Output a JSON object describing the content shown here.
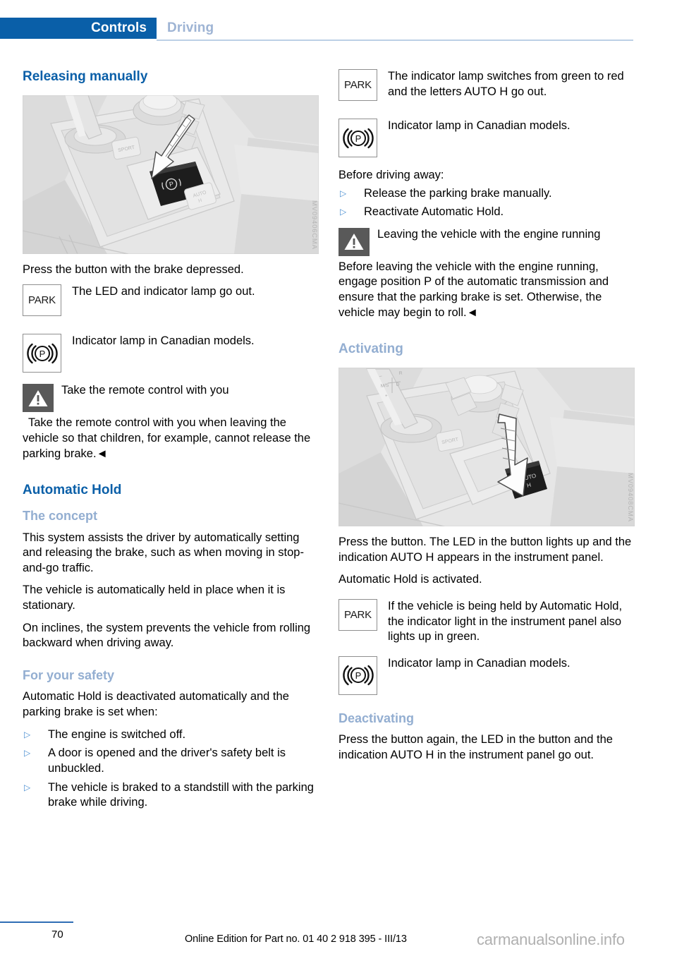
{
  "header": {
    "tab_label": "Controls",
    "section_label": "Driving"
  },
  "left_column": {
    "title": "Releasing manually",
    "figure": {
      "caption_wm": "MV09406CMA",
      "alt": "Center console with arrow pointing at parking brake button"
    },
    "intro": "Press the button with the brake depressed.",
    "icon_items": [
      {
        "icon": "park-indicator-icon",
        "icon_label": "PARK",
        "text": "The LED and indicator lamp go out."
      },
      {
        "icon": "canadian-parking-brake-icon",
        "icon_label": "((P))",
        "text": "Indicator lamp in Canadian models."
      }
    ],
    "warning": {
      "icon": "warning-triangle-icon",
      "title": "Take the remote control with you",
      "body_first": "Take the remote control with you when",
      "body_rest": "leaving the vehicle so that children, for example, cannot release the parking brake.◄"
    },
    "automatic_hold_title": "Automatic Hold",
    "concept_title": "The concept",
    "concept_paragraphs": [
      "This system assists the driver by automatically setting and releasing the brake, such as when moving in stop-and-go traffic.",
      "The vehicle is automatically held in place when it is stationary.",
      "On inclines, the system prevents the vehicle from rolling backward when driving away."
    ],
    "safety_title": "For your safety",
    "safety_intro": "Automatic Hold is deactivated automatically and the parking brake is set when:",
    "safety_bullets": [
      "The engine is switched off.",
      "A door is opened and the driver's safety belt is unbuckled.",
      "The vehicle is braked to a standstill with the parking brake while driving."
    ]
  },
  "right_column": {
    "icon_items_top": [
      {
        "icon": "park-indicator-icon",
        "icon_label": "PARK",
        "text": "The indicator lamp switches from green to red and the letters AUTO H go out."
      },
      {
        "icon": "canadian-parking-brake-icon",
        "icon_label": "((P))",
        "text": "Indicator lamp in Canadian models."
      }
    ],
    "before_driving_title": "Before driving away:",
    "before_driving_bullets": [
      "Release the parking brake manually.",
      "Reactivate Automatic Hold."
    ],
    "warning": {
      "icon": "warning-triangle-icon",
      "title": "Leaving the vehicle with the engine running",
      "body": "Before leaving the vehicle with the engine running, engage position P of the automatic transmission and ensure that the parking brake is set. Otherwise, the vehicle may begin to roll.◄"
    },
    "activating_title": "Activating",
    "figure": {
      "caption_wm": "MV09408CMA",
      "alt": "Center console with arrow pointing down at the Automatic Hold button"
    },
    "activating_paragraphs": [
      "Press the button. The LED in the button lights up and the indication AUTO H appears in the instrument panel.",
      "Automatic Hold is activated."
    ],
    "icon_items_bottom": [
      {
        "icon": "park-indicator-icon",
        "icon_label": "PARK",
        "text": "If the vehicle is being held by Automatic Hold, the indicator light in the instrument panel also lights up in green."
      },
      {
        "icon": "canadian-parking-brake-icon",
        "icon_label": "((P))",
        "text": "Indicator lamp in Canadian models."
      }
    ],
    "deactivating_title": "Deactivating",
    "deactivating_text": "Press the button again, the LED in the button and the indication AUTO H in the instrument panel go out."
  },
  "footer": {
    "page_number": "70",
    "edition": "Online Edition for Part no. 01 40 2 918 395 - III/13",
    "watermark": "carmanualsonline.info"
  },
  "colors": {
    "tab_blue": "#0a5fa8",
    "heading_blue": "#0a5fa8",
    "subheading_blue": "#93aed1",
    "muted_tab_text": "#9eb4d4",
    "bullet_blue": "#4b8fd1",
    "rule_blue": "#bcd0e6",
    "footer_rule": "#2f6db5"
  },
  "bullet_glyph": "▷"
}
